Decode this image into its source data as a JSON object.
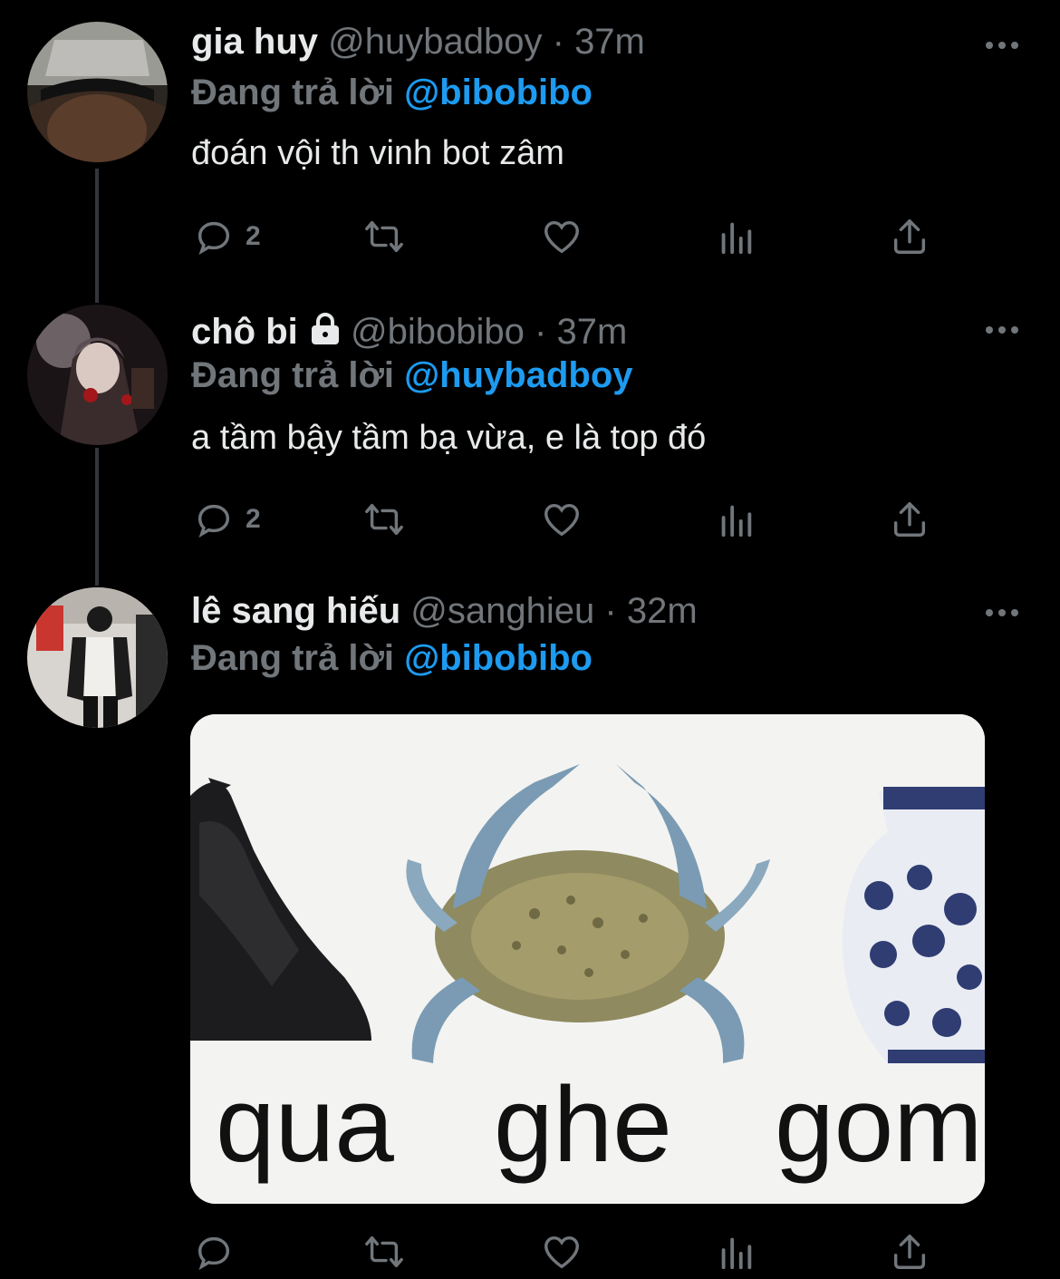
{
  "tweets": [
    {
      "name": "gia huy",
      "handle": "@huybadboy",
      "separator": "·",
      "time": "37m",
      "replying_prefix": "Đang trả lời",
      "replying_to": "@bibobibo",
      "text": "đoán vội th vinh bot zâm",
      "reply_count": "2"
    },
    {
      "name": "chô bi",
      "handle": "@bibobibo",
      "separator": "·",
      "time": "37m",
      "replying_prefix": "Đang trả lời",
      "replying_to": "@huybadboy",
      "text": "a tầm bậy tầm bạ vừa, e là top đó",
      "reply_count": "2"
    },
    {
      "name": "lê sang hiếu",
      "handle": "@sanghieu",
      "separator": "·",
      "time": "32m",
      "replying_prefix": "Đang trả lời",
      "replying_to": "@bibobibo",
      "media_caption": [
        "qua",
        "ghe",
        "gom"
      ]
    }
  ],
  "icons": [
    "reply-icon",
    "retweet-icon",
    "like-icon",
    "views-icon",
    "share-icon",
    "more-icon",
    "lock-icon"
  ],
  "colors": {
    "background": "#000000",
    "text": "#e7e9ea",
    "muted": "#71767b",
    "accent": "#1d9bf0"
  }
}
